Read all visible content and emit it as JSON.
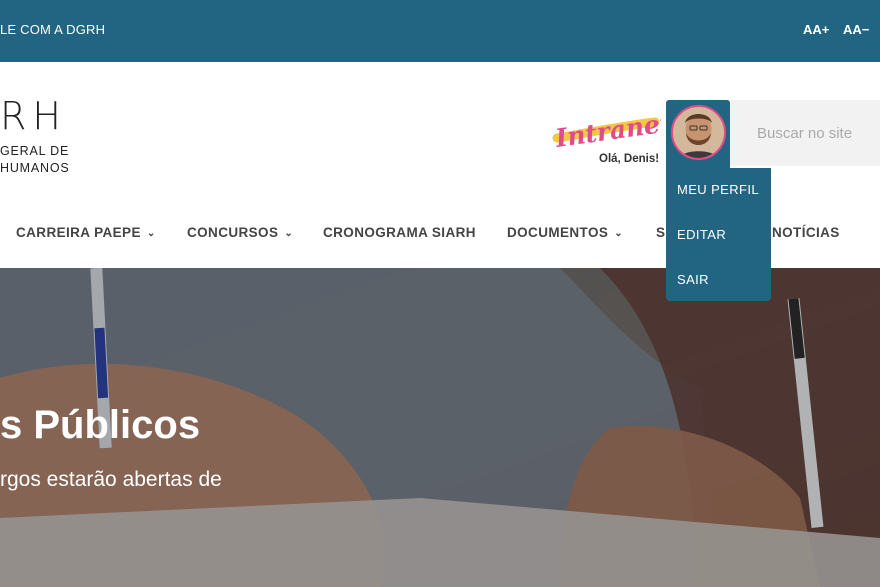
{
  "topbar": {
    "contact": "LE COM A DGRH",
    "font_increase": "AA+",
    "font_decrease": "AA−"
  },
  "logo": {
    "mark": "RH",
    "line1": "GERAL DE",
    "line2": "HUMANOS"
  },
  "user": {
    "intranet_logo_text": "Intranet",
    "greeting": "Olá, Denis!"
  },
  "search": {
    "placeholder": "Buscar no site"
  },
  "nav": {
    "items": [
      {
        "label": "CARREIRA PAEPE",
        "dropdown": true
      },
      {
        "label": "CONCURSOS",
        "dropdown": true
      },
      {
        "label": "CRONOGRAMA SIARH",
        "dropdown": false
      },
      {
        "label": "DOCUMENTOS",
        "dropdown": true
      },
      {
        "label": "S",
        "dropdown": false
      },
      {
        "label": "NOTÍCIAS",
        "dropdown": false
      }
    ]
  },
  "profile_menu": {
    "items": [
      "MEU PERFIL",
      "EDITAR",
      "SAIR"
    ]
  },
  "hero": {
    "title": "s Públicos",
    "subtitle": "rgos estarão abertas de"
  },
  "colors": {
    "primary": "#216582",
    "accent_pink": "#e04b8a",
    "intranet_yellow": "#f5c842"
  }
}
